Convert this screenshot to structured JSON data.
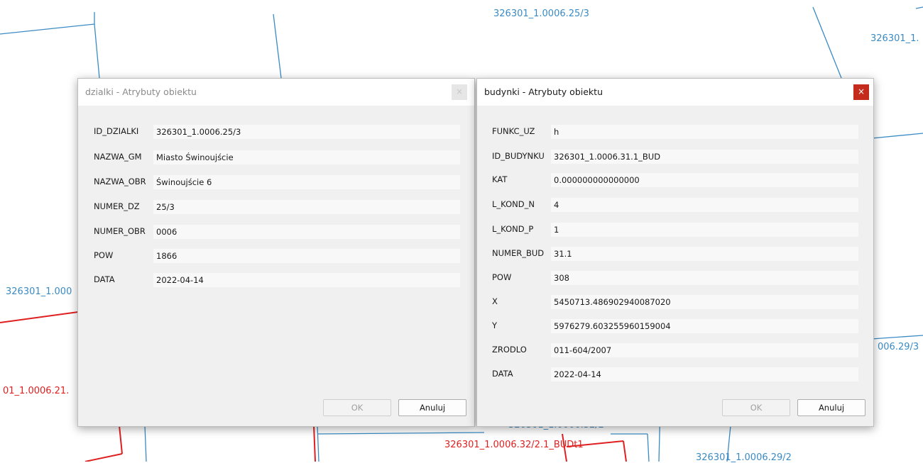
{
  "map": {
    "labels": [
      {
        "text": "326301_1.0006.25/3",
        "color": "blue"
      },
      {
        "text": "326301_1.",
        "color": "blue"
      },
      {
        "text": "326301_1.000",
        "color": "blue"
      },
      {
        "text": "006.29/3",
        "color": "blue"
      },
      {
        "text": "01_1.0006.21.",
        "color": "red"
      },
      {
        "text": "326301_1.0006.32/2",
        "color": "blue"
      },
      {
        "text": "326301_1.0006.32/2.1_BUDt1",
        "color": "red"
      },
      {
        "text": "326301_1.0006.29/2",
        "color": "blue"
      }
    ]
  },
  "dialog_dzialki": {
    "title": "dzialki - Atrybuty obiektu",
    "close_icon": "×",
    "fields": [
      {
        "label": "ID_DZIALKI",
        "value": "326301_1.0006.25/3"
      },
      {
        "label": "NAZWA_GM",
        "value": "Miasto Świnoujście"
      },
      {
        "label": "NAZWA_OBR",
        "value": "Świnoujście 6"
      },
      {
        "label": "NUMER_DZ",
        "value": "25/3"
      },
      {
        "label": "NUMER_OBR",
        "value": "0006"
      },
      {
        "label": "POW",
        "value": "1866"
      },
      {
        "label": "DATA",
        "value": "2022-04-14"
      }
    ],
    "ok_label": "OK",
    "cancel_label": "Anuluj"
  },
  "dialog_budynki": {
    "title": "budynki - Atrybuty obiektu",
    "close_icon": "×",
    "fields": [
      {
        "label": "FUNKC_UZ",
        "value": "h"
      },
      {
        "label": "ID_BUDYNKU",
        "value": "326301_1.0006.31.1_BUD"
      },
      {
        "label": "KAT",
        "value": "0.000000000000000"
      },
      {
        "label": "L_KOND_N",
        "value": "4"
      },
      {
        "label": "L_KOND_P",
        "value": "1"
      },
      {
        "label": "NUMER_BUD",
        "value": "31.1"
      },
      {
        "label": "POW",
        "value": "308"
      },
      {
        "label": "X",
        "value": "5450713.486902940087020"
      },
      {
        "label": "Y",
        "value": "5976279.603255960159004"
      },
      {
        "label": "ZRODLO",
        "value": "011-604/2007"
      },
      {
        "label": "DATA",
        "value": "2022-04-14"
      }
    ],
    "ok_label": "OK",
    "cancel_label": "Anuluj"
  }
}
